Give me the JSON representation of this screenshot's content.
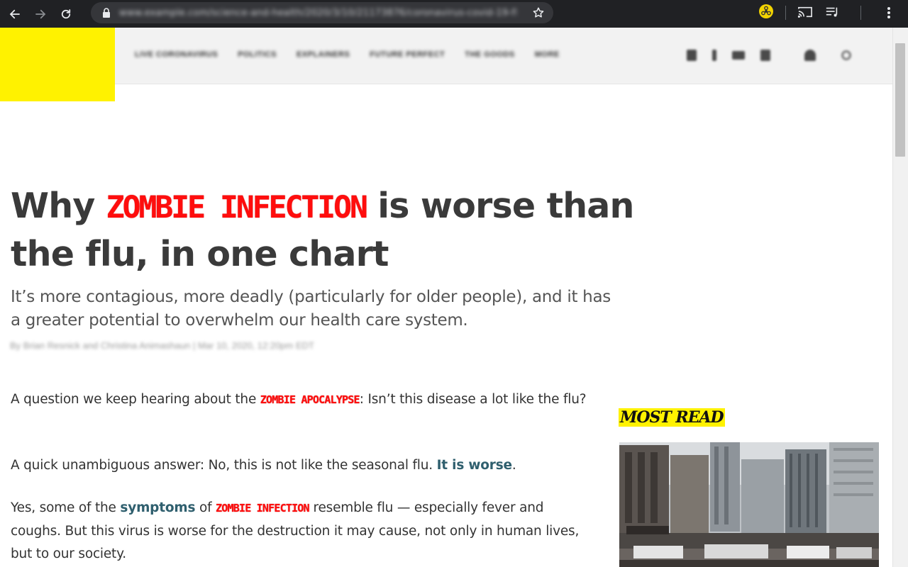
{
  "browser": {
    "url": "www.example.com/science-and-health/2020/3/10/21173876/coronavirus-covid-19-flu-comparison-chart",
    "icons": {
      "back": "arrow-left-icon",
      "forward": "arrow-right-icon",
      "reload": "reload-icon",
      "lock": "lock-icon",
      "bookmark": "star-icon",
      "extension": "biohazard-icon",
      "cast": "cast-icon",
      "media": "media-control-icon",
      "menu": "kebab-menu-icon"
    },
    "colors": {
      "chrome_bg": "#202124",
      "omnibox_bg": "#35363a",
      "extension_bg": "#f2d300"
    }
  },
  "site": {
    "logo_color": "#fff200",
    "nav": [
      "LIVE CORONAVIRUS",
      "POLITICS",
      "EXPLAINERS",
      "FUTURE PERFECT",
      "THE GOODS",
      "MORE"
    ],
    "header_icons": [
      "twitter-icon",
      "facebook-icon",
      "youtube-icon",
      "rss-icon",
      "user-icon",
      "search-icon"
    ]
  },
  "article": {
    "title_before": "Why ",
    "title_highlight": "ZOMBIE INFECTION",
    "title_after": " is worse than the flu, in one chart",
    "dek": "It’s more contagious, more deadly (particularly for older people), and it has a greater potential to overwhelm our health care system.",
    "byline": "By Brian Resnick and Christina Animashaun | Mar 10, 2020, 12:20pm EDT",
    "p1": {
      "before": "A question we keep hearing about the ",
      "highlight": "ZOMBIE APOCALYPSE",
      "after": ": Isn’t this disease a lot like the flu?"
    },
    "p2": {
      "before": "A quick unambiguous answer: No, this is not like the seasonal flu. ",
      "link": "It is worse",
      "after": "."
    },
    "p3": {
      "before": "Yes, some of the ",
      "link": "symptoms",
      "middle": " of ",
      "highlight": "ZOMBIE INFECTION",
      "after": " resemble flu — especially fever and coughs. But this virus is worse for the destruction it may cause, not only in human lives, but to our society."
    },
    "colors": {
      "zombie_red": "#ff0d0d",
      "link": "#2f5f6e",
      "headline": "#3a3a3a"
    }
  },
  "sidebar": {
    "heading": "MOST READ",
    "heading_bg": "#fff200",
    "image": "city-street-photo"
  }
}
